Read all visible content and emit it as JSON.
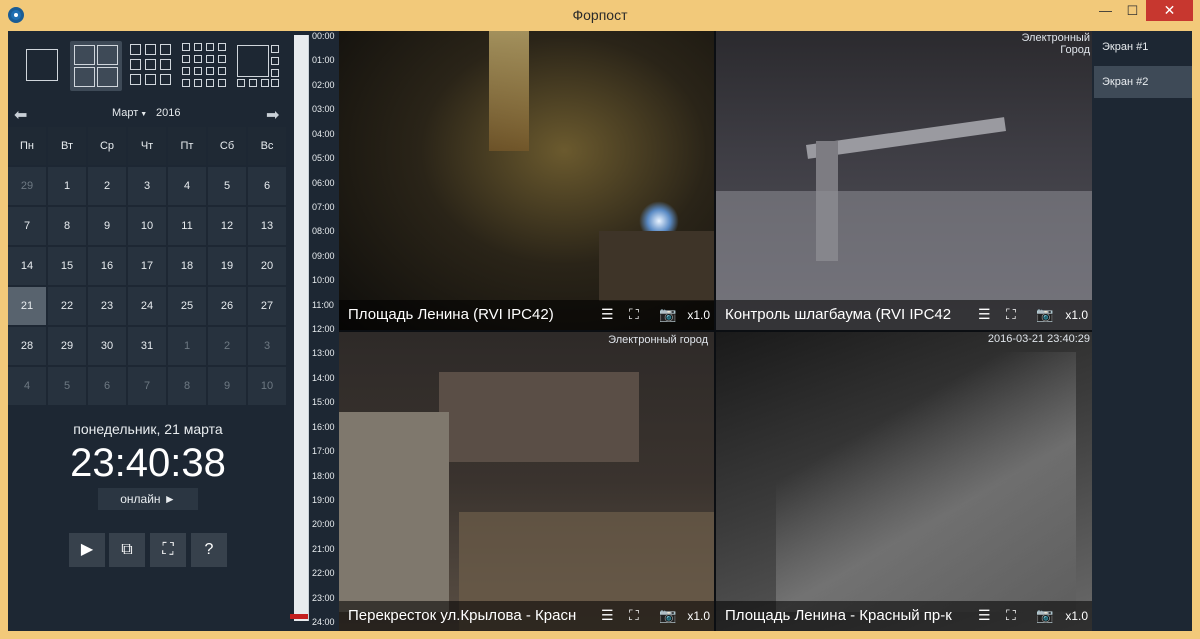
{
  "window": {
    "title": "Форпост",
    "min": "—",
    "max": "☐",
    "close": "✕"
  },
  "calendar": {
    "month": "Март",
    "year": "2016",
    "weekdays": [
      "Пн",
      "Вт",
      "Ср",
      "Чт",
      "Пт",
      "Сб",
      "Вс"
    ],
    "weeks": [
      [
        "29",
        "1",
        "2",
        "3",
        "4",
        "5",
        "6"
      ],
      [
        "7",
        "8",
        "9",
        "10",
        "11",
        "12",
        "13"
      ],
      [
        "14",
        "15",
        "16",
        "17",
        "18",
        "19",
        "20"
      ],
      [
        "21",
        "22",
        "23",
        "24",
        "25",
        "26",
        "27"
      ],
      [
        "28",
        "29",
        "30",
        "31",
        "1",
        "2",
        "3"
      ],
      [
        "4",
        "5",
        "6",
        "7",
        "8",
        "9",
        "10"
      ]
    ],
    "selected_day": "21"
  },
  "status": {
    "date_text": "понедельник, 21 марта",
    "time": "23:40:38",
    "online_label": "онлайн ►"
  },
  "controls": {
    "play": "▶",
    "split": "⧉",
    "fullscreen": "⛶",
    "help": "?"
  },
  "timeline": {
    "hours": [
      "00:00",
      "01:00",
      "02:00",
      "03:00",
      "04:00",
      "05:00",
      "06:00",
      "07:00",
      "08:00",
      "09:00",
      "10:00",
      "11:00",
      "12:00",
      "13:00",
      "14:00",
      "15:00",
      "16:00",
      "17:00",
      "18:00",
      "19:00",
      "20:00",
      "21:00",
      "22:00",
      "23:00",
      "24:00"
    ]
  },
  "cameras": [
    {
      "name": "Площадь Ленина (RVI IPC42)",
      "zoom": "x1.0",
      "watermark": ""
    },
    {
      "name": "Контроль шлагбаума (RVI IPC42",
      "zoom": "x1.0",
      "watermark": "Электронный Город"
    },
    {
      "name": "Перекресток ул.Крылова - Красн",
      "zoom": "x1.0",
      "watermark": "Электронный город"
    },
    {
      "name": "Площадь Ленина - Красный пр-к",
      "zoom": "x1.0",
      "watermark": "2016-03-21 23:40:29"
    }
  ],
  "screens": [
    "Экран #1",
    "Экран #2"
  ],
  "selected_screen": 1
}
